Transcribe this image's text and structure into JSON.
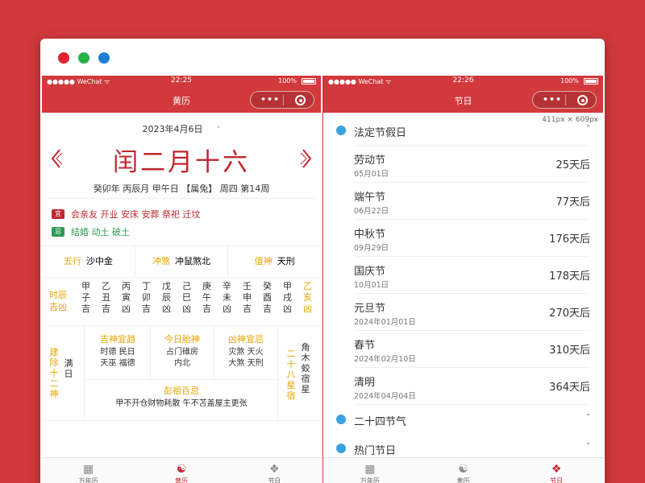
{
  "colors": {
    "background": "#d1393c",
    "brand_red": "#c0272d",
    "gold": "#e8a400",
    "green": "#2f9a52"
  },
  "left": {
    "status": {
      "carrier": "●●●●● WeChat ᯤ",
      "time": "22:25",
      "battery": "100%"
    },
    "nav_title": "黄历",
    "date": "2023年4月6日",
    "date_chevron": "ˇ",
    "lunar_date": "闰二月十六",
    "ganzhi": "癸卯年 丙辰月 甲午日 【属兔】 周四 第14周",
    "yi": {
      "tag": "宜",
      "text": "会亲友 开业 安床 安葬 祭祀 迁坟"
    },
    "ji": {
      "tag": "忌",
      "text": "结婚 动土 破土"
    },
    "wuxing": {
      "k": "五行",
      "v": "沙中金"
    },
    "chongsha": {
      "k": "冲煞",
      "v": "冲鼠煞北"
    },
    "zhishen": {
      "k": "值神",
      "v": "天刑"
    },
    "hours_label": "时辰吉凶",
    "hours": [
      {
        "line1": "甲",
        "line2": "子",
        "line3": "吉"
      },
      {
        "line1": "乙",
        "line2": "丑",
        "line3": "吉"
      },
      {
        "line1": "丙",
        "line2": "寅",
        "line3": "凶"
      },
      {
        "line1": "丁",
        "line2": "卯",
        "line3": "吉"
      },
      {
        "line1": "戊",
        "line2": "辰",
        "line3": "凶"
      },
      {
        "line1": "己",
        "line2": "巳",
        "line3": "凶"
      },
      {
        "line1": "庚",
        "line2": "午",
        "line3": "吉"
      },
      {
        "line1": "辛",
        "line2": "未",
        "line3": "凶"
      },
      {
        "line1": "壬",
        "line2": "申",
        "line3": "吉"
      },
      {
        "line1": "癸",
        "line2": "酉",
        "line3": "吉"
      },
      {
        "line1": "甲",
        "line2": "戌",
        "line3": "凶"
      },
      {
        "line1": "乙",
        "line2": "亥",
        "line3": "凶"
      }
    ],
    "jianchu_label": "建除十二神",
    "jianchu_value": "满日",
    "jishen": {
      "title": "吉神宜趋",
      "body1": "时德 民日",
      "body2": "天巫 福德"
    },
    "taishen": {
      "title": "今日胎神",
      "body1": "占门碓房",
      "body2": "内北"
    },
    "xiongshen": {
      "title": "凶神宜忌",
      "body1": "灾煞 天火",
      "body2": "大煞 天刑"
    },
    "xingxiu_label": "二十八星宿",
    "xingxiu_value": "角木蛟宿星",
    "pengzu": {
      "title": "彭祖百忌",
      "body": "甲不开仓财物耗散 午不苫盖屋主更张"
    },
    "tabs": [
      {
        "label": "万年历",
        "icon": "calendar-icon"
      },
      {
        "label": "黄历",
        "icon": "yinyang-icon"
      },
      {
        "label": "节日",
        "icon": "festival-icon"
      }
    ]
  },
  "right": {
    "status": {
      "carrier": "●●●●● WeChat ᯤ",
      "time": "22:26",
      "battery": "100%"
    },
    "nav_title": "节日",
    "size_badge": "411px × 609px",
    "section1": "法定节假日",
    "section1_chevron": "ˆ",
    "festivals": [
      {
        "name": "劳动节",
        "date": "05月01日",
        "count": "25天后"
      },
      {
        "name": "端午节",
        "date": "06月22日",
        "count": "77天后"
      },
      {
        "name": "中秋节",
        "date": "09月29日",
        "count": "176天后"
      },
      {
        "name": "国庆节",
        "date": "10月01日",
        "count": "178天后"
      },
      {
        "name": "元旦节",
        "date": "2024年01月01日",
        "count": "270天后"
      },
      {
        "name": "春节",
        "date": "2024年02月10日",
        "count": "310天后"
      },
      {
        "name": "清明",
        "date": "2024年04月04日",
        "count": "364天后"
      }
    ],
    "section2": "二十四节气",
    "section3": "热门节日",
    "collapsed_chevron": "ˇ",
    "tabs": [
      {
        "label": "万年历",
        "icon": "calendar-icon"
      },
      {
        "label": "黄历",
        "icon": "yinyang-icon"
      },
      {
        "label": "节日",
        "icon": "festival-icon"
      }
    ]
  }
}
